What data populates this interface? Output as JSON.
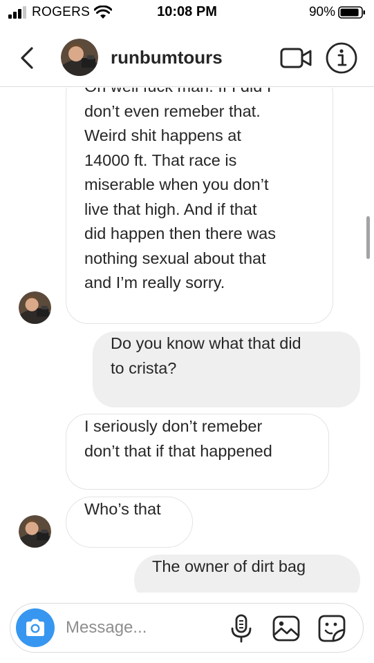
{
  "status_bar": {
    "carrier": "ROGERS",
    "time": "10:08 PM",
    "battery_percent": "90%",
    "battery_level": 0.9
  },
  "header": {
    "username": "runbumtours",
    "icons": [
      "chevron-left-icon",
      "video-call-icon",
      "info-icon"
    ]
  },
  "messages": [
    {
      "direction": "received",
      "lines": [
        "Oh well fuck man. If I did I",
        "don’t even remeber that.",
        "Weird shit happens at",
        "14000 ft. That race is",
        "miserable when you don’t",
        "live that high. And if that",
        "did happen then there was",
        "nothing sexual about that",
        "and I’m really sorry."
      ]
    },
    {
      "direction": "sent",
      "lines": [
        "Do you know what that did",
        "to crista?"
      ]
    },
    {
      "direction": "received",
      "lines": [
        "I seriously don’t remeber",
        "don’t that if that happened"
      ]
    },
    {
      "direction": "received",
      "lines": [
        "Who’s that"
      ]
    },
    {
      "direction": "sent",
      "lines": [
        "The owner of dirt bag"
      ]
    }
  ],
  "composer": {
    "placeholder": "Message...",
    "icons": [
      "camera-icon",
      "microphone-icon",
      "gallery-icon",
      "sticker-icon"
    ]
  },
  "colors": {
    "camera_button": "#3797f0",
    "sent_bubble": "#efefef",
    "received_border": "#e3e3e3"
  }
}
